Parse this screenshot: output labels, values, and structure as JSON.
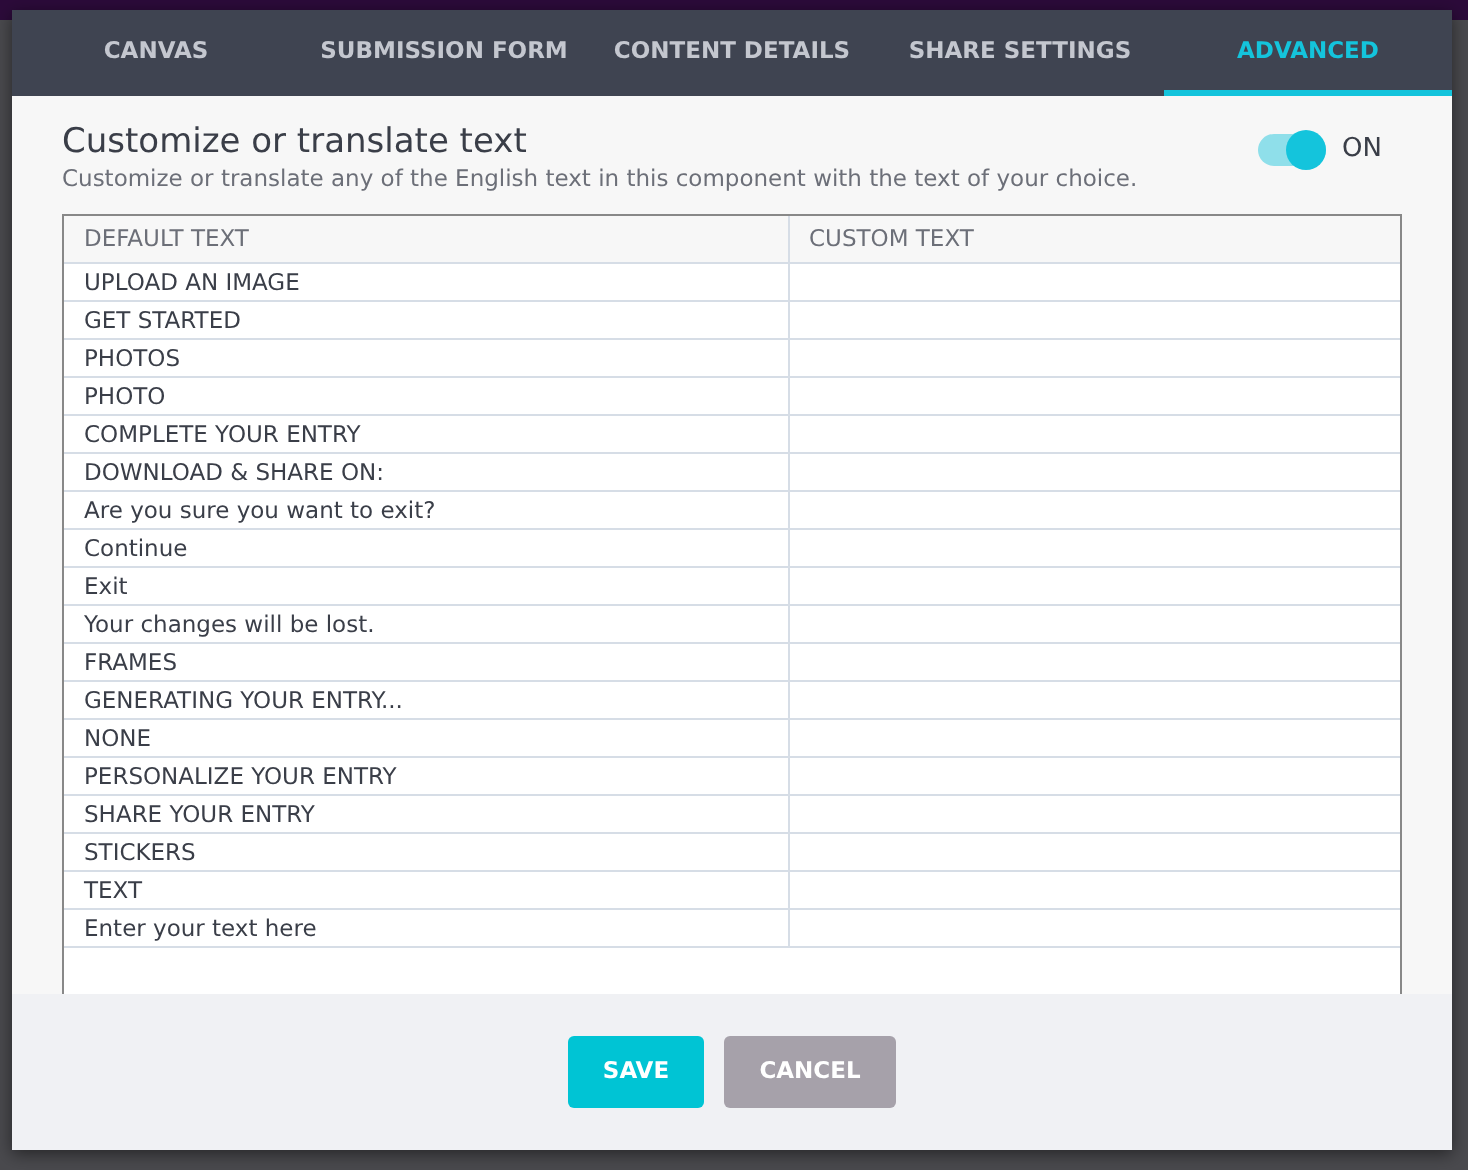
{
  "tabs": [
    {
      "label": "CANVAS",
      "selected": false
    },
    {
      "label": "SUBMISSION FORM",
      "selected": false
    },
    {
      "label": "CONTENT DETAILS",
      "selected": false
    },
    {
      "label": "SHARE SETTINGS",
      "selected": false
    },
    {
      "label": "ADVANCED",
      "selected": true
    }
  ],
  "section": {
    "title": "Customize or translate text",
    "description": "Customize or translate any of the English text in this component with the text of your choice.",
    "toggle": {
      "on": true,
      "label": "ON"
    }
  },
  "table": {
    "columns": [
      "DEFAULT TEXT",
      "CUSTOM TEXT"
    ],
    "rows": [
      {
        "default": "UPLOAD AN IMAGE"
      },
      {
        "default": "GET STARTED"
      },
      {
        "default": "PHOTOS"
      },
      {
        "default": "PHOTO"
      },
      {
        "default": "COMPLETE YOUR ENTRY"
      },
      {
        "default": "DOWNLOAD & SHARE ON:"
      },
      {
        "default": "Are you sure you want to exit?"
      },
      {
        "default": "Continue"
      },
      {
        "default": "Exit"
      },
      {
        "default": "Your changes will be lost."
      },
      {
        "default": "FRAMES"
      },
      {
        "default": "GENERATING YOUR ENTRY..."
      },
      {
        "default": "NONE"
      },
      {
        "default": "PERSONALIZE YOUR ENTRY"
      },
      {
        "default": "SHARE YOUR ENTRY"
      },
      {
        "default": "STICKERS"
      },
      {
        "default": "TEXT"
      },
      {
        "default": "Enter your text here"
      }
    ]
  },
  "buttons": [
    {
      "label": "SAVE",
      "kind": "primary"
    },
    {
      "label": "CANCEL",
      "kind": "secondary"
    }
  ]
}
